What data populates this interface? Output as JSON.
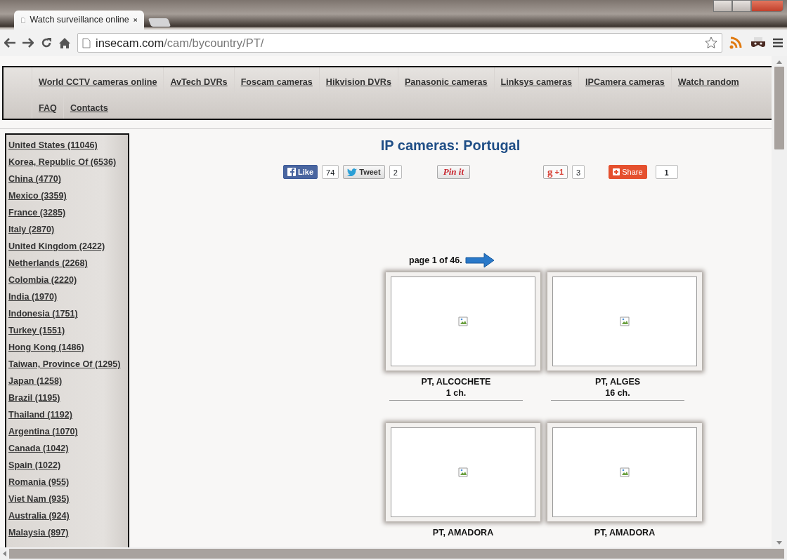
{
  "browser": {
    "tabs": [
      {
        "title": "Watch surveillance online",
        "selected": true
      }
    ],
    "url_host": "insecam.com",
    "url_path": "/cam/bycountry/PT/"
  },
  "nav": {
    "items": [
      "World CCTV cameras online",
      "AvTech DVRs",
      "Foscam cameras",
      "Hikvision DVRs",
      "Panasonic cameras",
      "Linksys cameras",
      "IPCamera cameras",
      "Watch random",
      "FAQ",
      "Contacts"
    ]
  },
  "sidebar": {
    "countries": [
      "United States (11046)",
      "Korea, Republic Of (6536)",
      "China (4770)",
      "Mexico (3359)",
      "France (3285)",
      "Italy (2870)",
      "United Kingdom (2422)",
      "Netherlands (2268)",
      "Colombia (2220)",
      "India (1970)",
      "Indonesia (1751)",
      "Turkey (1551)",
      "Hong Kong (1486)",
      "Taiwan, Province Of (1295)",
      "Japan (1258)",
      "Brazil (1195)",
      "Thailand (1192)",
      "Argentina (1070)",
      "Canada (1042)",
      "Spain (1022)",
      "Romania (955)",
      "Viet Nam (935)",
      "Australia (924)",
      "Malaysia (897)"
    ]
  },
  "title": "IP cameras: Portugal",
  "social": [
    {
      "kind": "facebook",
      "label": "Like",
      "count": "74"
    },
    {
      "kind": "twitter",
      "label": "Tweet",
      "count": "2"
    },
    {
      "kind": "pinterest",
      "label": "Pin it"
    },
    {
      "kind": "gplus",
      "logo": "g",
      "label": "+1",
      "count": "3"
    },
    {
      "kind": "share",
      "label": "Share",
      "count": "1"
    }
  ],
  "pagination": "page 1 of 46.",
  "cameras": [
    {
      "place": "PT, ALCOCHETE",
      "channels": "1 ch."
    },
    {
      "place": "PT, ALGES",
      "channels": "16 ch."
    },
    {
      "place": "PT, AMADORA"
    },
    {
      "place": "PT, AMADORA"
    }
  ]
}
